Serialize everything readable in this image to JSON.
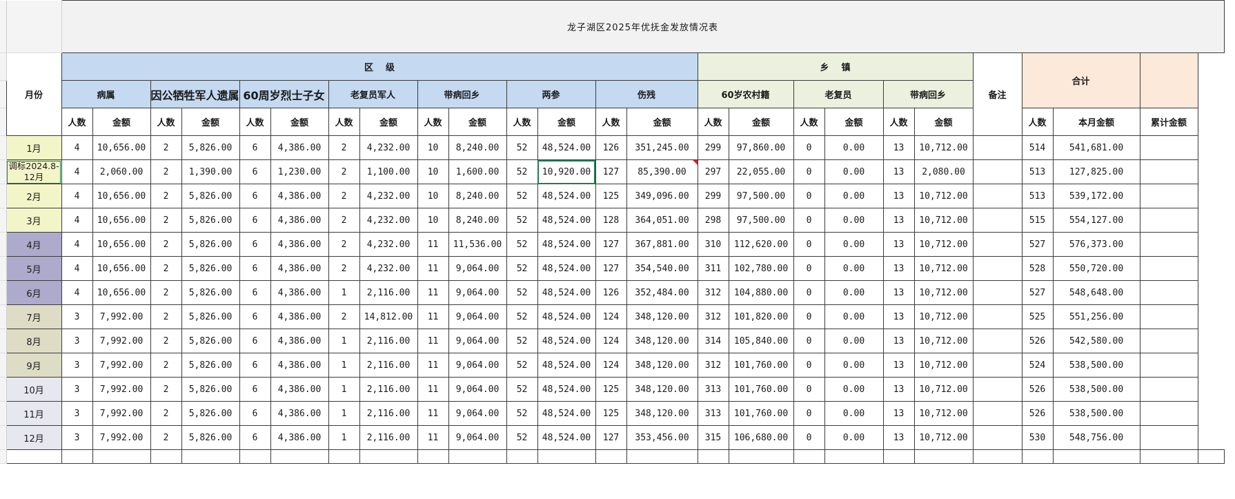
{
  "title": "龙子湖区2025年优抚金发放情况表",
  "headers": {
    "month": "月份",
    "district": "区    级",
    "township": "乡    镇",
    "remark": "备注",
    "total": "合计",
    "groups": [
      "病属",
      "因公牺牲军人遗属",
      "60周岁烈士子女",
      "老复员军人",
      "带病回乡",
      "两参",
      "伤残",
      "60岁农村籍",
      "老复员",
      "带病回乡"
    ],
    "people": "人数",
    "amount": "金额",
    "month_amount": "本月金额",
    "cumulative": "累计金额"
  },
  "rows": [
    {
      "month": "1月",
      "cells": [
        "4",
        "10,656.00",
        "2",
        "5,826.00",
        "6",
        "4,386.00",
        "2",
        "4,232.00",
        "10",
        "8,240.00",
        "52",
        "48,524.00",
        "126",
        "351,245.00",
        "299",
        "97,860.00",
        "0",
        "0.00",
        "13",
        "10,712.00",
        "514",
        "541,681.00"
      ]
    },
    {
      "month": "调标2024.8-12月",
      "cells": [
        "4",
        "2,060.00",
        "2",
        "1,390.00",
        "6",
        "1,230.00",
        "2",
        "1,100.00",
        "10",
        "1,600.00",
        "52",
        "10,920.00",
        "127",
        "85,390.00",
        "297",
        "22,055.00",
        "0",
        "0.00",
        "13",
        "2,080.00",
        "513",
        "127,825.00"
      ]
    },
    {
      "month": "2月",
      "cells": [
        "4",
        "10,656.00",
        "2",
        "5,826.00",
        "6",
        "4,386.00",
        "2",
        "4,232.00",
        "10",
        "8,240.00",
        "52",
        "48,524.00",
        "125",
        "349,096.00",
        "299",
        "97,500.00",
        "0",
        "0.00",
        "13",
        "10,712.00",
        "513",
        "539,172.00"
      ]
    },
    {
      "month": "3月",
      "cells": [
        "4",
        "10,656.00",
        "2",
        "5,826.00",
        "6",
        "4,386.00",
        "2",
        "4,232.00",
        "10",
        "8,240.00",
        "52",
        "48,524.00",
        "128",
        "364,051.00",
        "298",
        "97,500.00",
        "0",
        "0.00",
        "13",
        "10,712.00",
        "515",
        "554,127.00"
      ]
    },
    {
      "month": "4月",
      "cells": [
        "4",
        "10,656.00",
        "2",
        "5,826.00",
        "6",
        "4,386.00",
        "2",
        "4,232.00",
        "11",
        "11,536.00",
        "52",
        "48,524.00",
        "127",
        "367,881.00",
        "310",
        "112,620.00",
        "0",
        "0.00",
        "13",
        "10,712.00",
        "527",
        "576,373.00"
      ]
    },
    {
      "month": "5月",
      "cells": [
        "4",
        "10,656.00",
        "2",
        "5,826.00",
        "6",
        "4,386.00",
        "2",
        "4,232.00",
        "11",
        "9,064.00",
        "52",
        "48,524.00",
        "127",
        "354,540.00",
        "311",
        "102,780.00",
        "0",
        "0.00",
        "13",
        "10,712.00",
        "528",
        "550,720.00"
      ]
    },
    {
      "month": "6月",
      "cells": [
        "4",
        "10,656.00",
        "2",
        "5,826.00",
        "6",
        "4,386.00",
        "1",
        "2,116.00",
        "11",
        "9,064.00",
        "52",
        "48,524.00",
        "126",
        "352,484.00",
        "312",
        "104,880.00",
        "0",
        "0.00",
        "13",
        "10,712.00",
        "527",
        "548,648.00"
      ]
    },
    {
      "month": "7月",
      "cells": [
        "3",
        "7,992.00",
        "2",
        "5,826.00",
        "6",
        "4,386.00",
        "2",
        "14,812.00",
        "11",
        "9,064.00",
        "52",
        "48,524.00",
        "124",
        "348,120.00",
        "312",
        "101,820.00",
        "0",
        "0.00",
        "13",
        "10,712.00",
        "525",
        "551,256.00"
      ]
    },
    {
      "month": "8月",
      "cells": [
        "3",
        "7,992.00",
        "2",
        "5,826.00",
        "6",
        "4,386.00",
        "1",
        "2,116.00",
        "11",
        "9,064.00",
        "52",
        "48,524.00",
        "124",
        "348,120.00",
        "314",
        "105,840.00",
        "0",
        "0.00",
        "13",
        "10,712.00",
        "526",
        "542,580.00"
      ]
    },
    {
      "month": "9月",
      "cells": [
        "3",
        "7,992.00",
        "2",
        "5,826.00",
        "6",
        "4,386.00",
        "1",
        "2,116.00",
        "11",
        "9,064.00",
        "52",
        "48,524.00",
        "124",
        "348,120.00",
        "312",
        "101,760.00",
        "0",
        "0.00",
        "13",
        "10,712.00",
        "524",
        "538,500.00"
      ]
    },
    {
      "month": "10月",
      "cells": [
        "3",
        "7,992.00",
        "2",
        "5,826.00",
        "6",
        "4,386.00",
        "1",
        "2,116.00",
        "11",
        "9,064.00",
        "52",
        "48,524.00",
        "125",
        "348,120.00",
        "313",
        "101,760.00",
        "0",
        "0.00",
        "13",
        "10,712.00",
        "526",
        "538,500.00"
      ]
    },
    {
      "month": "11月",
      "cells": [
        "3",
        "7,992.00",
        "2",
        "5,826.00",
        "6",
        "4,386.00",
        "1",
        "2,116.00",
        "11",
        "9,064.00",
        "52",
        "48,524.00",
        "125",
        "348,120.00",
        "313",
        "101,760.00",
        "0",
        "0.00",
        "13",
        "10,712.00",
        "526",
        "538,500.00"
      ]
    },
    {
      "month": "12月",
      "cells": [
        "3",
        "7,992.00",
        "2",
        "5,826.00",
        "6",
        "4,386.00",
        "1",
        "2,116.00",
        "11",
        "9,064.00",
        "52",
        "48,524.00",
        "127",
        "353,456.00",
        "315",
        "106,680.00",
        "0",
        "0.00",
        "13",
        "10,712.00",
        "530",
        "548,756.00"
      ]
    }
  ],
  "colors": {
    "district_header": "#c5d9f1",
    "township_header": "#ebf1de",
    "total_header": "#fde9d9",
    "selection": "#1e7f4f",
    "comment_marker": "#e02020"
  },
  "selected_cell": {
    "row": 1,
    "column": "两参 金额"
  },
  "comment_cell": {
    "row": 1,
    "column": "伤残 金额"
  }
}
